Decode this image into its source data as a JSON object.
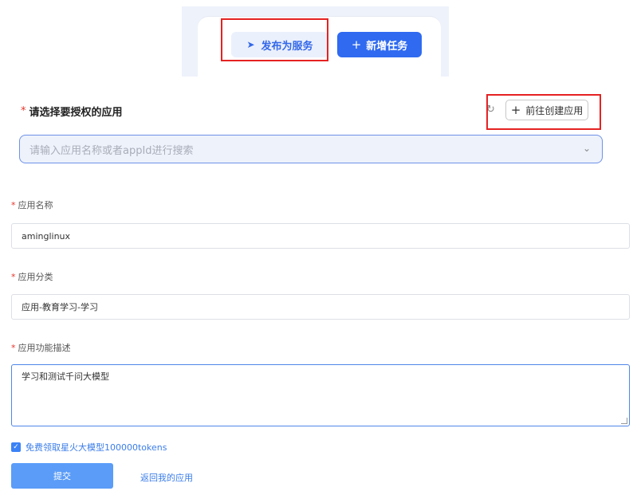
{
  "top_bar": {
    "publish_label": "发布为服务",
    "new_task_label": "新增任务"
  },
  "app_select": {
    "required_mark": "*",
    "title": "请选择要授权的应用",
    "create_app_label": "前往创建应用",
    "search_placeholder": "请输入应用名称或者appId进行搜索"
  },
  "form": {
    "required_mark": "*",
    "name_label": "应用名称",
    "name_value": "aminglinux",
    "category_label": "应用分类",
    "category_value": "应用-教育学习-学习",
    "description_label": "应用功能描述",
    "description_value": "学习和测试千问大模型",
    "free_tokens_label": "免费领取星火大模型100000tokens",
    "free_tokens_checked": true,
    "submit_label": "提交",
    "back_label": "返回我的应用"
  },
  "colors": {
    "primary": "#2f6af0",
    "highlight_box": "#e52222",
    "required": "#e5352b"
  }
}
